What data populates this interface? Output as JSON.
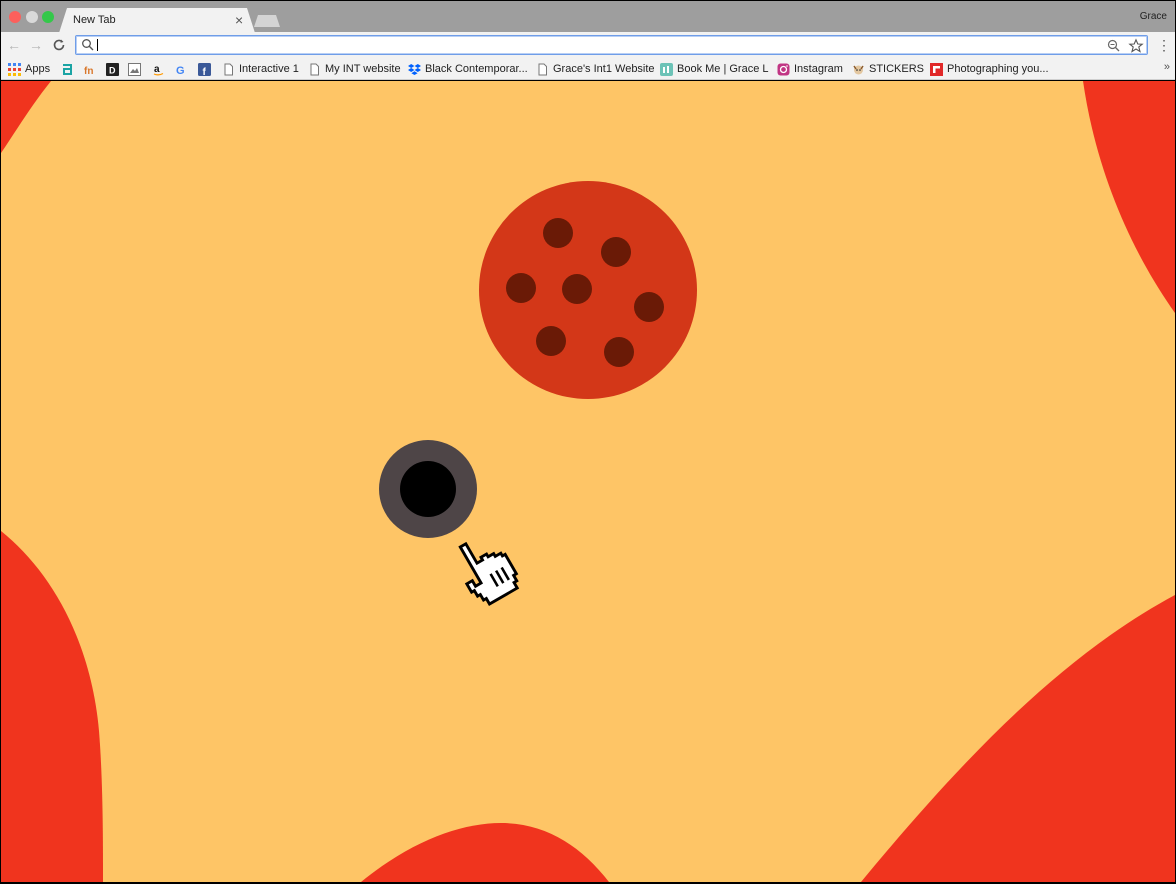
{
  "window": {
    "profile_name": "Grace"
  },
  "tabs": [
    {
      "title": "New Tab",
      "close_icon": "×"
    }
  ],
  "toolbar": {
    "back_icon": "←",
    "forward_icon": "→",
    "reload_icon": "C",
    "address_value": "",
    "menu_icon": "⋮"
  },
  "bookmarks": [
    {
      "label": "Apps",
      "icon": "apps-grid-icon",
      "color": "#4285f4"
    },
    {
      "label": "",
      "icon": "teal-a-icon",
      "color": "#1ba4a4"
    },
    {
      "label": "",
      "icon": "fn-icon",
      "color": "#d9772b"
    },
    {
      "label": "",
      "icon": "d-icon",
      "color": "#222222"
    },
    {
      "label": "",
      "icon": "image-icon",
      "color": "#777777"
    },
    {
      "label": "",
      "icon": "amazon-icon",
      "color": "#111111"
    },
    {
      "label": "",
      "icon": "google-icon",
      "color": "#4285f4"
    },
    {
      "label": "",
      "icon": "facebook-icon",
      "color": "#3b5998"
    },
    {
      "label": "Interactive 1",
      "icon": "page-icon",
      "color": "#777777"
    },
    {
      "label": "My INT website",
      "icon": "page-icon",
      "color": "#777777"
    },
    {
      "label": "Black Contemporar...",
      "icon": "dropbox-icon",
      "color": "#0061fe"
    },
    {
      "label": "Grace's Int1 Website",
      "icon": "page-icon",
      "color": "#777777"
    },
    {
      "label": "Book Me | Grace L",
      "icon": "calendar-icon",
      "color": "#6cc3b7"
    },
    {
      "label": "Instagram",
      "icon": "instagram-icon",
      "color": "#c13584"
    },
    {
      "label": "STICKERS",
      "icon": "sticker-icon",
      "color": "#8a5a2b"
    },
    {
      "label": "Photographing you...",
      "icon": "flipboard-icon",
      "color": "#e12828"
    }
  ],
  "bookmarks_overflow": "»",
  "page": {
    "background": "#fec566",
    "blob_color": "#f0341e",
    "pizza_color": "#d33718",
    "pepperoni_color": "#6a1a06",
    "ring_color": "#4e4547",
    "hole_color": "#000000"
  }
}
